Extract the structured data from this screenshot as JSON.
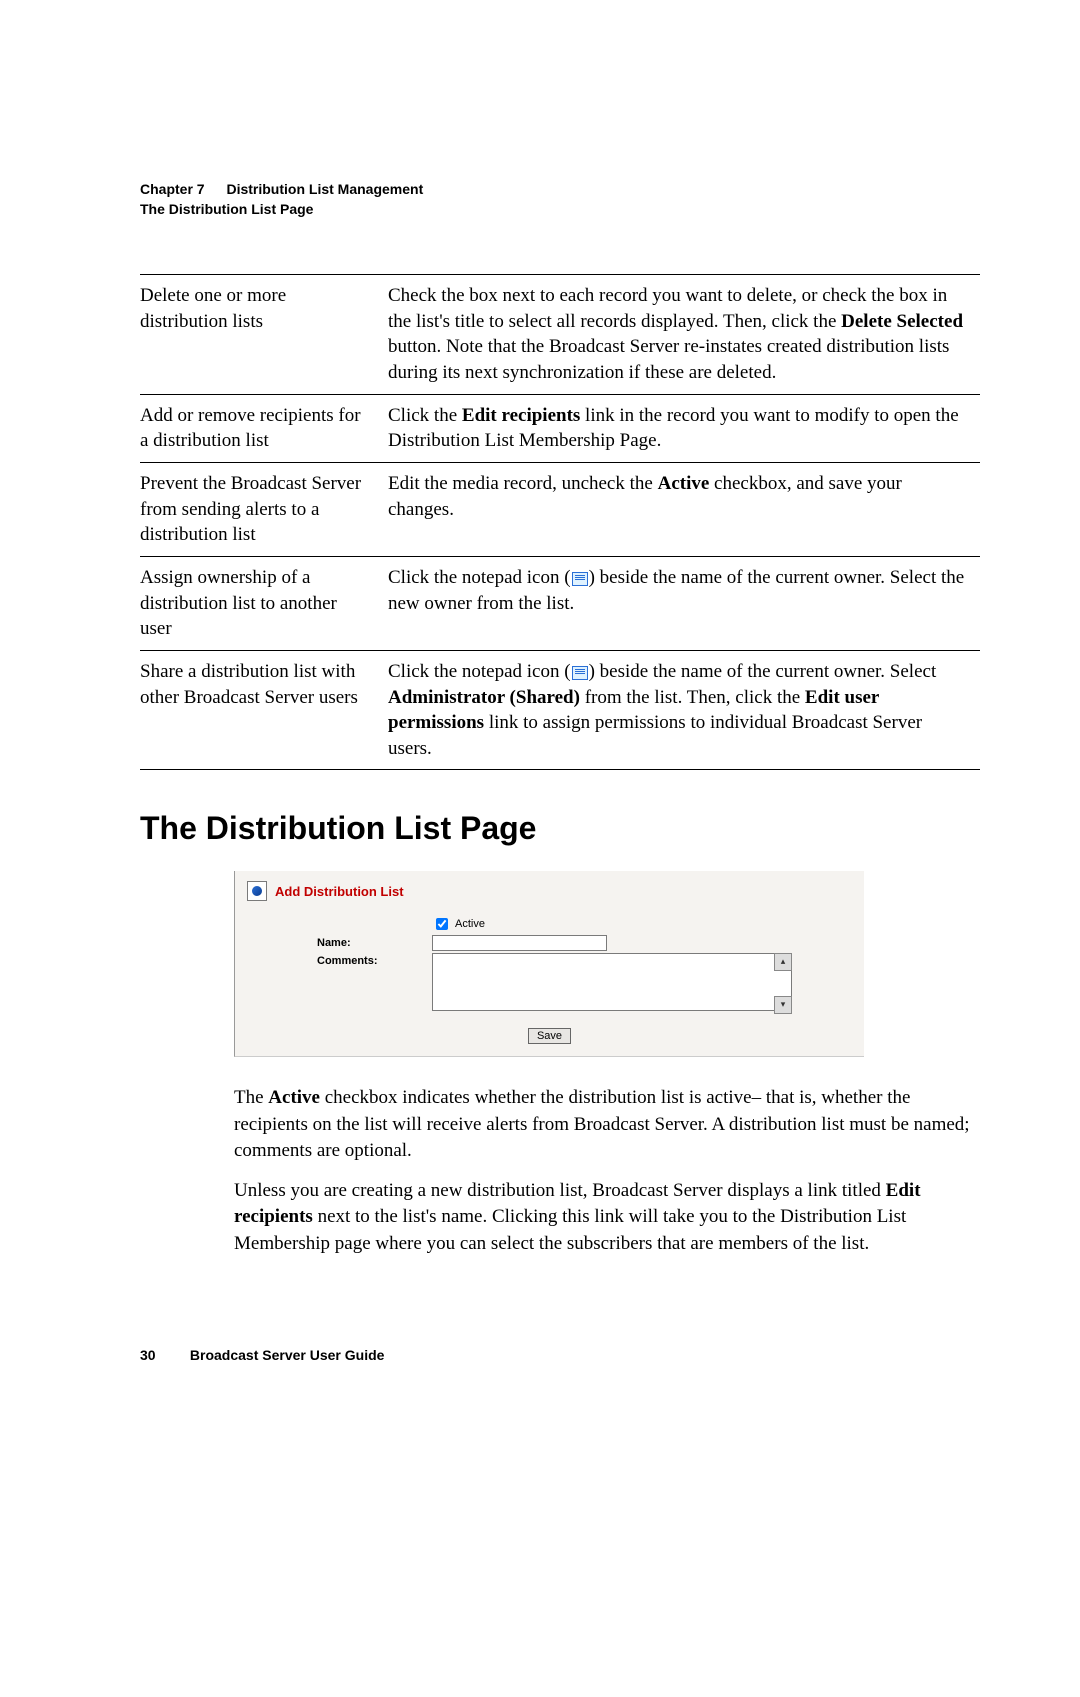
{
  "header": {
    "chapter_label": "Chapter 7",
    "chapter_title": "Distribution List Management",
    "subtitle": "The Distribution List Page"
  },
  "table_rows": [
    {
      "task": "Delete one or more distribution lists",
      "desc_pre": "Check the box next to each record you want to delete, or check the box in the list's title to select all records displayed. Then, click the ",
      "desc_b1": "Delete Selected",
      "desc_post": " button. Note that the Broadcast Server re-instates created distribution lists during its next synchronization if these are deleted."
    },
    {
      "task": "Add or remove recipients for a distribution list",
      "desc_pre": "Click the ",
      "desc_b1": "Edit recipients",
      "desc_post": " link in the record you want to modify to open the Distribution List Membership Page."
    },
    {
      "task": "Prevent the Broadcast Server from sending alerts to a distribution list",
      "desc_pre": "Edit the media record, uncheck the ",
      "desc_b1": "Active",
      "desc_post": " checkbox, and save your changes."
    },
    {
      "task": "Assign ownership of a distribution list to another user",
      "desc_pre": "Click the notepad icon (",
      "icon": true,
      "desc_post": ") beside the name of the current owner. Select the new owner from the list."
    },
    {
      "task": "Share a distribution list with other Broadcast Server users",
      "desc_pre": "Click the notepad icon (",
      "icon": true,
      "desc_mid": ") beside the name of the current owner. Select ",
      "desc_b1": "Administrator (Shared)",
      "desc_mid2": " from the list. Then, click the ",
      "desc_b2": "Edit user permissions",
      "desc_post": " link to assign permissions to individual Broadcast Server users."
    }
  ],
  "section_heading": "The Distribution List Page",
  "screenshot": {
    "title": "Add Distribution List",
    "active_label": "Active",
    "active_checked": true,
    "name_label": "Name:",
    "name_value": "",
    "comments_label": "Comments:",
    "comments_value": "",
    "save_label": "Save"
  },
  "para1": {
    "pre": "The ",
    "b1": "Active",
    "post": " checkbox indicates whether the distribution list is active– that is, whether the recipients on the list will receive alerts from Broadcast Server. A distribution list must be named; comments are optional."
  },
  "para2": {
    "pre": "Unless you are creating a new distribution list, Broadcast Server displays a link titled ",
    "b1": "Edit recipients",
    "post": " next to the list's name. Clicking this link will take you to the Distribution List Membership page where you can select the subscribers that are members of the list."
  },
  "footer": {
    "page_number": "30",
    "doc_title": "Broadcast Server User Guide"
  }
}
